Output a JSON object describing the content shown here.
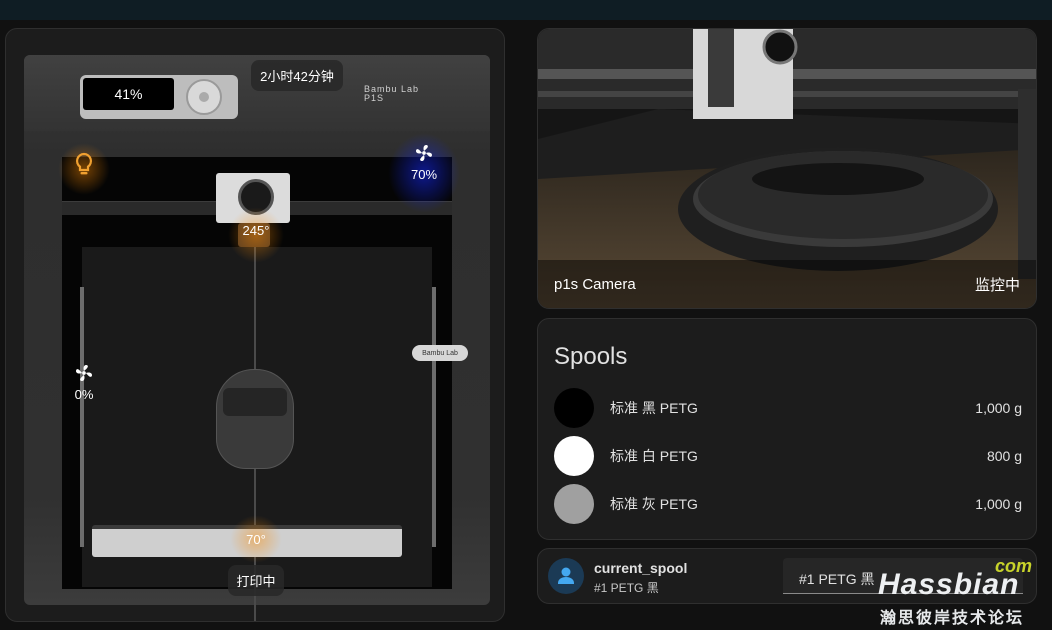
{
  "printer": {
    "progress": "41%",
    "remaining_time": "2小时42分钟",
    "brand_line1": "Bambu Lab",
    "brand_line2": "P1S",
    "side_tag": "Bambu Lab",
    "aux_fan": "70%",
    "nozzle_temp": "245°",
    "chamber_fan": "0%",
    "bed_temp": "70°",
    "status": "打印中",
    "light_on": true,
    "colors": {
      "light": "#f0a030",
      "heat_glow": "#ff8c00",
      "fan_glow": "#1428ff"
    }
  },
  "camera": {
    "title": "p1s Camera",
    "state": "监控中"
  },
  "spools": {
    "title": "Spools",
    "items": [
      {
        "name": "标准 黑 PETG",
        "weight": "1,000 g",
        "color": "#000000"
      },
      {
        "name": "标准 白 PETG",
        "weight": "800 g",
        "color": "#ffffff"
      },
      {
        "name": "标准 灰 PETG",
        "weight": "1,000 g",
        "color": "#a0a0a0"
      }
    ]
  },
  "current_spool": {
    "entity": "current_spool",
    "state": "#1 PETG 黑",
    "selected": "#1 PETG 黑",
    "icon": "account-icon"
  },
  "watermark": {
    "com": "com",
    "main": "Hassbian",
    "sub": "瀚思彼岸技术论坛"
  }
}
